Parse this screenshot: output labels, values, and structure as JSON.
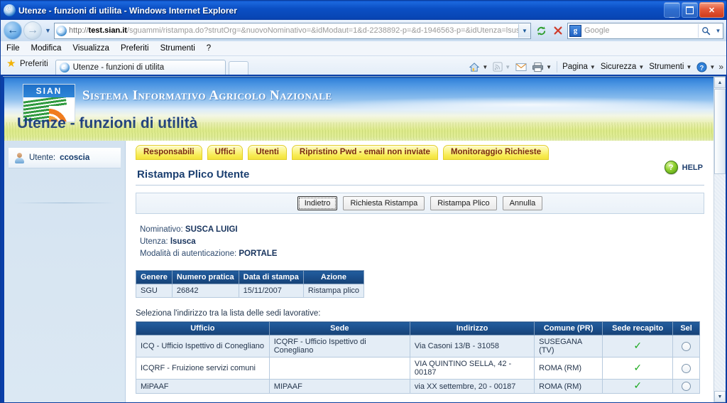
{
  "window": {
    "title": "Utenze - funzioni di utilita - Windows Internet Explorer",
    "minimize_label": "_",
    "maximize_label": "",
    "close_label": "×"
  },
  "nav": {
    "back_icon": "back-arrow-icon",
    "forward_icon": "forward-arrow-icon",
    "history_dropdown_icon": "chevron-down-icon",
    "url": "http://test.sian.it/sguammi/ristampa.do?strutOrg=&nuovoNominativo=&idModaut=1&d-2238892-p=&d-1946563-p=&idUtenza=lsusca&l",
    "url_scheme": "http://",
    "url_host": "test.sian.it",
    "url_path": "/sguammi/ristampa.do?strutOrg=&nuovoNominativo=&idModaut=1&d-2238892-p=&d-1946563-p=&idUtenza=lsusca&l",
    "refresh_icon": "refresh-icon",
    "stop_icon": "stop-icon",
    "search_placeholder": "Google",
    "search_value": "",
    "search_engine": "Google"
  },
  "menu": {
    "items": [
      {
        "label": "File"
      },
      {
        "label": "Modifica"
      },
      {
        "label": "Visualizza"
      },
      {
        "label": "Preferiti"
      },
      {
        "label": "Strumenti"
      },
      {
        "label": "?"
      }
    ]
  },
  "favbar": {
    "favorites_label": "Preferiti",
    "tab_label": "Utenze - funzioni di utilita",
    "new_tab_label": ""
  },
  "cmdbar": {
    "home_icon": "home-icon",
    "feeds_icon": "rss-feed-icon",
    "mail_icon": "mail-icon",
    "print_icon": "printer-icon",
    "items": [
      {
        "label": "Pagina"
      },
      {
        "label": "Sicurezza"
      },
      {
        "label": "Strumenti"
      }
    ],
    "help_icon": "help-circle-icon",
    "overflow_label": "»"
  },
  "banner": {
    "logo_text": "SIAN",
    "title": "Sistema Informativo Agricolo Nazionale",
    "subtitle": "Utenze - funzioni di utilità"
  },
  "sidebar": {
    "user_label": "Utente:",
    "user_name": "ccoscia"
  },
  "tabs": [
    {
      "label": "Responsabili"
    },
    {
      "label": "Uffici"
    },
    {
      "label": "Utenti"
    },
    {
      "label": "Ripristino Pwd - email non inviate"
    },
    {
      "label": "Monitoraggio Richieste"
    }
  ],
  "help": {
    "label": "HELP"
  },
  "main": {
    "page_title": "Ristampa Plico Utente",
    "buttons": [
      {
        "label": "Indietro",
        "focused": true
      },
      {
        "label": "Richiesta Ristampa",
        "focused": false
      },
      {
        "label": "Ristampa Plico",
        "focused": false
      },
      {
        "label": "Annulla",
        "focused": false
      }
    ],
    "info": {
      "nominativo_label": "Nominativo:",
      "nominativo_value": "SUSCA LUIGI",
      "utenza_label": "Utenza:",
      "utenza_value": "lsusca",
      "modalita_label": "Modalità di autenticazione:",
      "modalita_value": "PORTALE"
    },
    "pratiche_table": {
      "headers": [
        "Genere",
        "Numero pratica",
        "Data di stampa",
        "Azione"
      ],
      "rows": [
        {
          "genere": "SGU",
          "numero": "26842",
          "data": "15/11/2007",
          "azione": "Ristampa plico"
        }
      ]
    },
    "sedi_intro": "Seleziona l'indirizzo tra la lista delle sedi lavorative:",
    "sedi_table": {
      "headers": [
        "Ufficio",
        "Sede",
        "Indirizzo",
        "Comune (PR)",
        "Sede recapito",
        "Sel"
      ],
      "rows": [
        {
          "ufficio": "ICQ - Ufficio Ispettivo di Conegliano",
          "sede": "ICQRF - Ufficio Ispettivo di Conegliano",
          "indirizzo": "Via Casoni 13/B - 31058",
          "comune": "SUSEGANA (TV)",
          "recapito": "✓",
          "selected": false
        },
        {
          "ufficio": "ICQRF - Fruizione servizi comuni",
          "sede": "",
          "indirizzo": "VIA QUINTINO SELLA, 42 - 00187",
          "comune": "ROMA (RM)",
          "recapito": "✓",
          "selected": false
        },
        {
          "ufficio": "MiPAAF",
          "sede": "MIPAAF",
          "indirizzo": "via XX settembre, 20 - 00187",
          "comune": "ROMA (RM)",
          "recapito": "✓",
          "selected": false
        }
      ]
    }
  },
  "colors": {
    "header_blue": "#1b4f8c",
    "tab_yellow": "#f7ea4e",
    "tab_text": "#7b2b12",
    "check_green": "#17a81a",
    "title_blue": "#1b3f70"
  }
}
